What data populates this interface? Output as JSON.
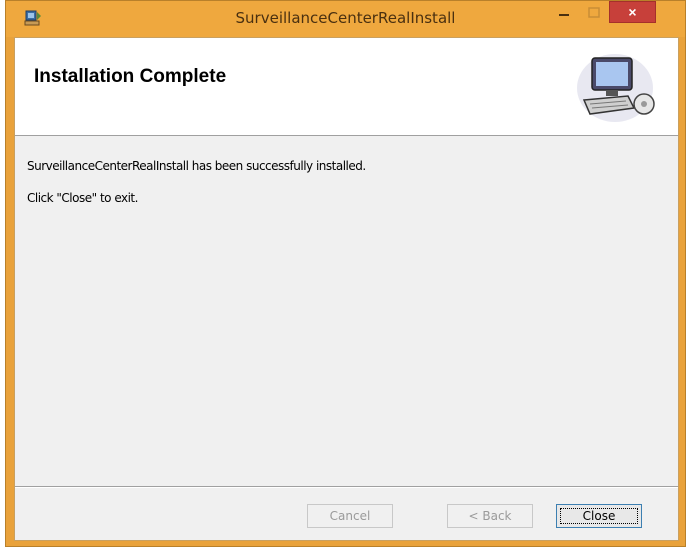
{
  "window": {
    "title": "SurveillanceCenterRealInstall",
    "close_glyph": "×"
  },
  "banner": {
    "title": "Installation Complete",
    "icon": "computer-install-icon"
  },
  "body": {
    "line1": "SurveillanceCenterRealInstall has been successfully installed.",
    "line2": "Click \"Close\" to exit."
  },
  "buttons": {
    "cancel": "Cancel",
    "back": "< Back",
    "close": "Close"
  },
  "colors": {
    "titlebar": "#efa83e",
    "close_button": "#c7403a"
  }
}
